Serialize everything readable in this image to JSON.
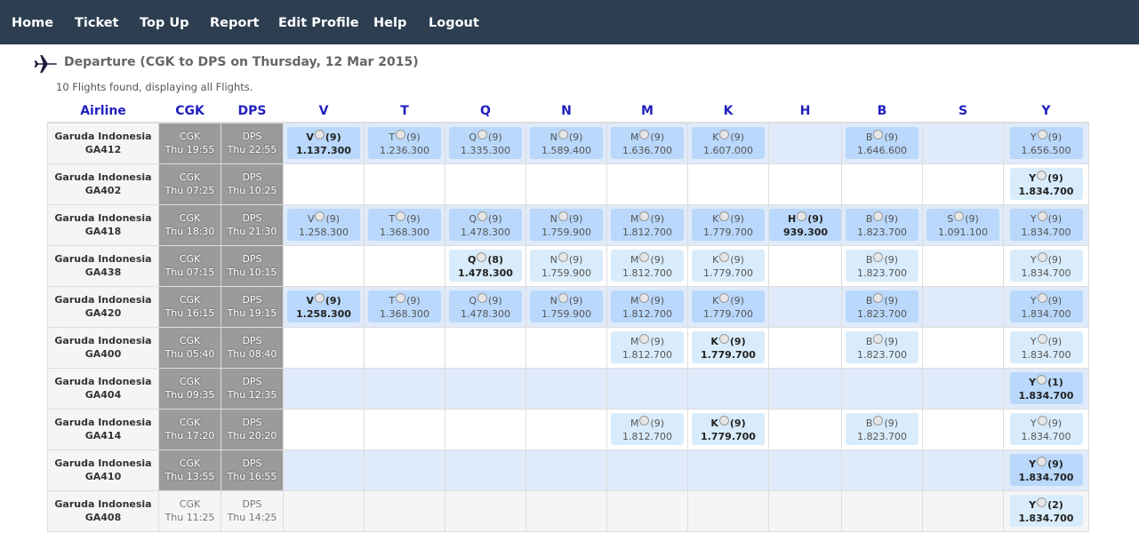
{
  "nav": {
    "items": [
      {
        "label": "Home"
      },
      {
        "label": "Ticket"
      },
      {
        "label": "Top Up"
      },
      {
        "label": "Report"
      },
      {
        "label": "Edit Profile"
      },
      {
        "label": "Help"
      },
      {
        "label": "Logout"
      }
    ]
  },
  "heading": {
    "icon": "airplane-icon",
    "title": "Departure (CGK to DPS on Thursday, 12 Mar 2015)",
    "found": "10 Flights found, displaying all Flights."
  },
  "columns": {
    "airline": "Airline",
    "origin": "CGK",
    "dest": "DPS",
    "classes": [
      "V",
      "T",
      "Q",
      "N",
      "M",
      "K",
      "H",
      "B",
      "S",
      "Y"
    ]
  },
  "colors": {
    "navbar": "#2c3e50",
    "header_text": "#1f1fbf",
    "row_blue": "#dfeafa",
    "seat_box_primary": "#b9d8fb",
    "seat_box_secondary": "#d9ecfb",
    "time_cell": "#9b9b9b"
  },
  "flights": [
    {
      "airline": "Garuda Indonesia",
      "flight_no": "GA412",
      "origin": "CGK",
      "dep_time": "Thu 19:55",
      "dest": "DPS",
      "arr_time": "Thu 22:55",
      "fares": [
        {
          "cls": "V",
          "seats": "(9)",
          "price": "1.137.300",
          "bold": true,
          "shade": "a"
        },
        {
          "cls": "T",
          "seats": "(9)",
          "price": "1.236.300",
          "shade": "a"
        },
        {
          "cls": "Q",
          "seats": "(9)",
          "price": "1.335.300",
          "shade": "a"
        },
        {
          "cls": "N",
          "seats": "(9)",
          "price": "1.589.400",
          "shade": "a"
        },
        {
          "cls": "M",
          "seats": "(9)",
          "price": "1.636.700",
          "shade": "a"
        },
        {
          "cls": "K",
          "seats": "(9)",
          "price": "1.607.000",
          "shade": "a"
        },
        null,
        {
          "cls": "B",
          "seats": "(9)",
          "price": "1.646.600",
          "shade": "a"
        },
        null,
        {
          "cls": "Y",
          "seats": "(9)",
          "price": "1.656.500",
          "shade": "a"
        }
      ]
    },
    {
      "airline": "Garuda Indonesia",
      "flight_no": "GA402",
      "origin": "CGK",
      "dep_time": "Thu 07:25",
      "dest": "DPS",
      "arr_time": "Thu 10:25",
      "fares": [
        null,
        null,
        null,
        null,
        null,
        null,
        null,
        null,
        null,
        {
          "cls": "Y",
          "seats": "(9)",
          "price": "1.834.700",
          "bold": true,
          "shade": "b"
        }
      ]
    },
    {
      "airline": "Garuda Indonesia",
      "flight_no": "GA418",
      "origin": "CGK",
      "dep_time": "Thu 18:30",
      "dest": "DPS",
      "arr_time": "Thu 21:30",
      "fares": [
        {
          "cls": "V",
          "seats": "(9)",
          "price": "1.258.300",
          "shade": "a"
        },
        {
          "cls": "T",
          "seats": "(9)",
          "price": "1.368.300",
          "shade": "a"
        },
        {
          "cls": "Q",
          "seats": "(9)",
          "price": "1.478.300",
          "shade": "a"
        },
        {
          "cls": "N",
          "seats": "(9)",
          "price": "1.759.900",
          "shade": "a"
        },
        {
          "cls": "M",
          "seats": "(9)",
          "price": "1.812.700",
          "shade": "a"
        },
        {
          "cls": "K",
          "seats": "(9)",
          "price": "1.779.700",
          "shade": "a"
        },
        {
          "cls": "H",
          "seats": "(9)",
          "price": "939.300",
          "bold": true,
          "shade": "a"
        },
        {
          "cls": "B",
          "seats": "(9)",
          "price": "1.823.700",
          "shade": "a"
        },
        {
          "cls": "S",
          "seats": "(9)",
          "price": "1.091.100",
          "shade": "a"
        },
        {
          "cls": "Y",
          "seats": "(9)",
          "price": "1.834.700",
          "shade": "a"
        }
      ]
    },
    {
      "airline": "Garuda Indonesia",
      "flight_no": "GA438",
      "origin": "CGK",
      "dep_time": "Thu 07:15",
      "dest": "DPS",
      "arr_time": "Thu 10:15",
      "fares": [
        null,
        null,
        {
          "cls": "Q",
          "seats": "(8)",
          "price": "1.478.300",
          "bold": true,
          "shade": "b"
        },
        {
          "cls": "N",
          "seats": "(9)",
          "price": "1.759.900",
          "shade": "b"
        },
        {
          "cls": "M",
          "seats": "(9)",
          "price": "1.812.700",
          "shade": "b"
        },
        {
          "cls": "K",
          "seats": "(9)",
          "price": "1.779.700",
          "shade": "b"
        },
        null,
        {
          "cls": "B",
          "seats": "(9)",
          "price": "1.823.700",
          "shade": "b"
        },
        null,
        {
          "cls": "Y",
          "seats": "(9)",
          "price": "1.834.700",
          "shade": "b"
        }
      ]
    },
    {
      "airline": "Garuda Indonesia",
      "flight_no": "GA420",
      "origin": "CGK",
      "dep_time": "Thu 16:15",
      "dest": "DPS",
      "arr_time": "Thu 19:15",
      "fares": [
        {
          "cls": "V",
          "seats": "(9)",
          "price": "1.258.300",
          "bold": true,
          "shade": "a"
        },
        {
          "cls": "T",
          "seats": "(9)",
          "price": "1.368.300",
          "shade": "a"
        },
        {
          "cls": "Q",
          "seats": "(9)",
          "price": "1.478.300",
          "shade": "a"
        },
        {
          "cls": "N",
          "seats": "(9)",
          "price": "1.759.900",
          "shade": "a"
        },
        {
          "cls": "M",
          "seats": "(9)",
          "price": "1.812.700",
          "shade": "a"
        },
        {
          "cls": "K",
          "seats": "(9)",
          "price": "1.779.700",
          "shade": "a"
        },
        null,
        {
          "cls": "B",
          "seats": "(9)",
          "price": "1.823.700",
          "shade": "a"
        },
        null,
        {
          "cls": "Y",
          "seats": "(9)",
          "price": "1.834.700",
          "shade": "a"
        }
      ]
    },
    {
      "airline": "Garuda Indonesia",
      "flight_no": "GA400",
      "origin": "CGK",
      "dep_time": "Thu 05:40",
      "dest": "DPS",
      "arr_time": "Thu 08:40",
      "fares": [
        null,
        null,
        null,
        null,
        {
          "cls": "M",
          "seats": "(9)",
          "price": "1.812.700",
          "shade": "b"
        },
        {
          "cls": "K",
          "seats": "(9)",
          "price": "1.779.700",
          "bold": true,
          "shade": "b"
        },
        null,
        {
          "cls": "B",
          "seats": "(9)",
          "price": "1.823.700",
          "shade": "b"
        },
        null,
        {
          "cls": "Y",
          "seats": "(9)",
          "price": "1.834.700",
          "shade": "b"
        }
      ]
    },
    {
      "airline": "Garuda Indonesia",
      "flight_no": "GA404",
      "origin": "CGK",
      "dep_time": "Thu 09:35",
      "dest": "DPS",
      "arr_time": "Thu 12:35",
      "fares": [
        null,
        null,
        null,
        null,
        null,
        null,
        null,
        null,
        null,
        {
          "cls": "Y",
          "seats": "(1)",
          "price": "1.834.700",
          "bold": true,
          "shade": "a"
        }
      ]
    },
    {
      "airline": "Garuda Indonesia",
      "flight_no": "GA414",
      "origin": "CGK",
      "dep_time": "Thu 17:20",
      "dest": "DPS",
      "arr_time": "Thu 20:20",
      "fares": [
        null,
        null,
        null,
        null,
        {
          "cls": "M",
          "seats": "(9)",
          "price": "1.812.700",
          "shade": "b"
        },
        {
          "cls": "K",
          "seats": "(9)",
          "price": "1.779.700",
          "bold": true,
          "shade": "b"
        },
        null,
        {
          "cls": "B",
          "seats": "(9)",
          "price": "1.823.700",
          "shade": "b"
        },
        null,
        {
          "cls": "Y",
          "seats": "(9)",
          "price": "1.834.700",
          "shade": "b"
        }
      ]
    },
    {
      "airline": "Garuda Indonesia",
      "flight_no": "GA410",
      "origin": "CGK",
      "dep_time": "Thu 13:55",
      "dest": "DPS",
      "arr_time": "Thu 16:55",
      "fares": [
        null,
        null,
        null,
        null,
        null,
        null,
        null,
        null,
        null,
        {
          "cls": "Y",
          "seats": "(9)",
          "price": "1.834.700",
          "bold": true,
          "shade": "a"
        }
      ]
    },
    {
      "airline": "Garuda Indonesia",
      "flight_no": "GA408",
      "origin": "CGK",
      "dep_time": "Thu 11:25",
      "dest": "DPS",
      "arr_time": "Thu 14:25",
      "time_style": "light",
      "fares": [
        null,
        null,
        null,
        null,
        null,
        null,
        null,
        null,
        null,
        {
          "cls": "Y",
          "seats": "(2)",
          "price": "1.834.700",
          "bold": true,
          "shade": "b"
        }
      ]
    }
  ]
}
